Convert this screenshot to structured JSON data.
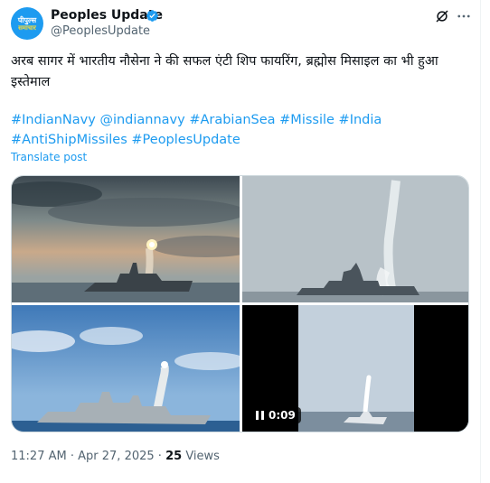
{
  "author": {
    "name": "Peoples Update",
    "handle": "@PeoplesUpdate",
    "avatar_line1": "पीपुल्स",
    "avatar_line2": "समाचार"
  },
  "tweet": {
    "text": "अरब सागर में भारतीय नौसेना ने की सफल एंटी शिप फायरिंग, ब्रह्मोस मिसाइल का भी हुआ इस्तेमाल",
    "hashtags": [
      "#IndianNavy",
      "@indiannavy",
      "#ArabianSea",
      "#Missile",
      "#India",
      "#AntiShipMissiles",
      "#PeoplesUpdate"
    ],
    "translate_label": "Translate post"
  },
  "media": {
    "video_duration": "0:09"
  },
  "meta": {
    "time": "11:27 AM",
    "separator": "·",
    "date": "Apr 27, 2025",
    "views_count": "25",
    "views_label": "Views"
  },
  "icons": [
    "verified-badge-icon",
    "grok-icon",
    "more-icon",
    "pause-icon"
  ],
  "colors": {
    "accent": "#1d9bf0",
    "text": "#0f1419",
    "muted": "#536471"
  }
}
